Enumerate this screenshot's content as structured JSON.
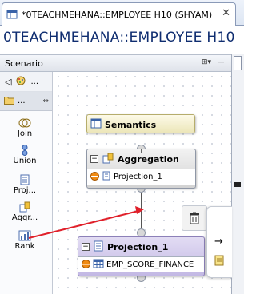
{
  "editor": {
    "tab_title": "*0TEACHMEHANA::EMPLOYEE H10 (SHYAM)",
    "close_glyph": "✕",
    "page_title": "0TEACHMEHANA::EMPLOYEE H10"
  },
  "scenario": {
    "label": "Scenario",
    "layout_btn": "⊞▾",
    "minimize_btn": "—"
  },
  "palette": {
    "nav_back": "◁",
    "nav_more": "...",
    "folder_label": "...",
    "folder_arrows": "⇔",
    "items": [
      {
        "label": "Join",
        "icon": "join-icon"
      },
      {
        "label": "Union",
        "icon": "union-icon"
      },
      {
        "label": "Proj...",
        "icon": "projection-icon"
      },
      {
        "label": "Aggr...",
        "icon": "aggregation-icon"
      },
      {
        "label": "Rank",
        "icon": "rank-icon"
      }
    ]
  },
  "nodes": {
    "semantics": {
      "label": "Semantics"
    },
    "aggregation": {
      "label": "Aggregation",
      "collapse": "−",
      "input": "Projection_1"
    },
    "projection": {
      "label": "Projection_1",
      "collapse": "−",
      "input": "EMP_SCORE_FINANCE"
    }
  },
  "popup": {
    "arrow_glyph": "→"
  },
  "colors": {
    "title": "#0f2d70",
    "annotation_arrow": "#e0202a",
    "semantics_bg": "#ece6b9",
    "projection_bg": "#c2b8e4"
  }
}
